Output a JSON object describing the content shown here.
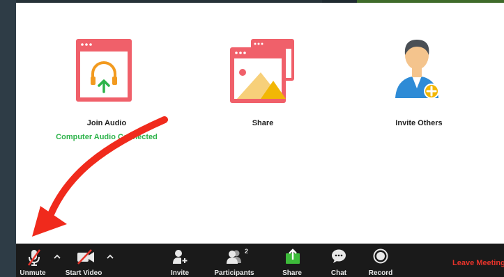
{
  "actions": {
    "join_audio": {
      "label": "Join Audio",
      "status": "Computer Audio Connected"
    },
    "share": {
      "label": "Share"
    },
    "invite_others": {
      "label": "Invite Others"
    }
  },
  "toolbar": {
    "unmute": "Unmute",
    "start_video": "Start Video",
    "invite": "Invite",
    "participants": "Participants",
    "participants_count": "2",
    "share": "Share",
    "chat": "Chat",
    "record": "Record",
    "leave": "Leave Meeting"
  },
  "colors": {
    "accent_red": "#e5332a",
    "window_red": "#f0606a",
    "status_green": "#2db34a",
    "toolbar_bg": "#1a1a1a",
    "share_green": "#3dbb3a"
  }
}
